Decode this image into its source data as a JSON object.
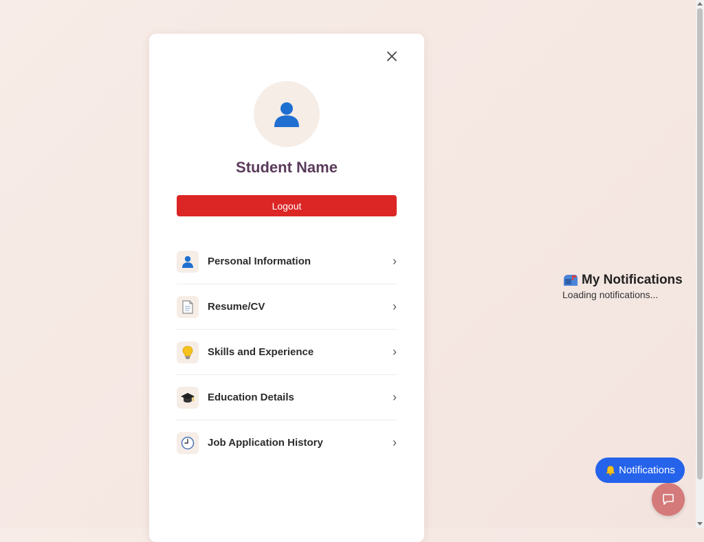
{
  "profile": {
    "close_icon": "close-icon",
    "avatar_icon": "person-icon",
    "name": "Student Name",
    "logout_label": "Logout",
    "logout_color": "#dc2626"
  },
  "menu": [
    {
      "icon": "person-icon",
      "label": "Personal Information"
    },
    {
      "icon": "document-icon",
      "label": "Resume/CV"
    },
    {
      "icon": "lightbulb-icon",
      "label": "Skills and Experience"
    },
    {
      "icon": "graduation-cap-icon",
      "label": "Education Details"
    },
    {
      "icon": "clock-icon",
      "label": "Job Application History"
    }
  ],
  "chevron": "›",
  "notifications_panel": {
    "icon": "mailbox-icon",
    "title": "My Notifications",
    "status": "Loading notifications..."
  },
  "notifications_button": {
    "icon": "bell-icon",
    "label": "Notifications",
    "color": "#2563eb"
  },
  "chat_button": {
    "icon": "chat-bubble-icon",
    "color": "#d47a7a"
  }
}
